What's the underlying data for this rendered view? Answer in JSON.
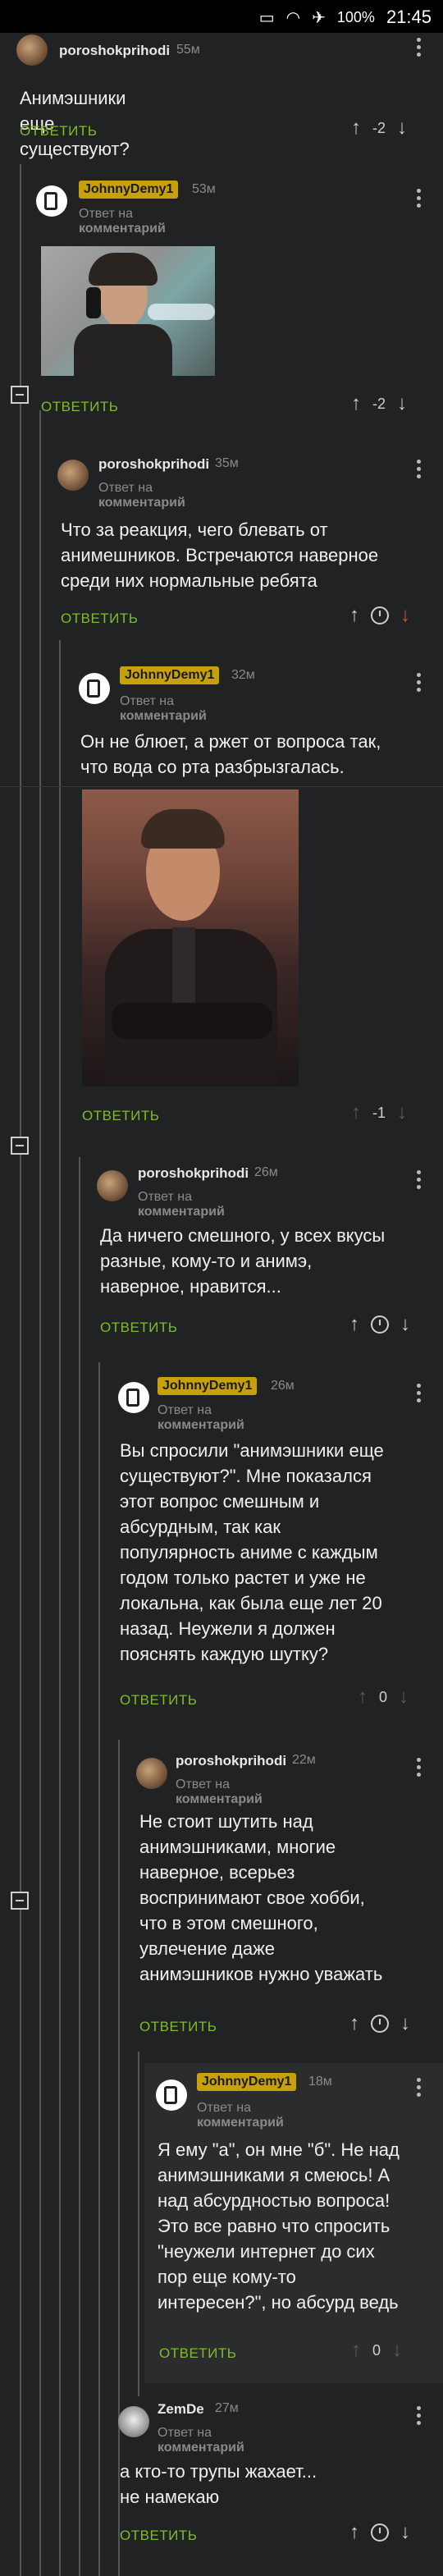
{
  "status": {
    "battery": "100%",
    "time": "21:45"
  },
  "comments": [
    {
      "user": "poroshokprihodi",
      "time": "55м",
      "text": "Анимэшники еще существуют?",
      "reply": "ОТВЕТИТЬ",
      "score": "-2"
    },
    {
      "user": "JohnnyDemy1",
      "time": "53м",
      "reply_to_prefix": "Ответ на",
      "reply_to_link": "комментарий",
      "reply": "ОТВЕТИТЬ",
      "score": "-2"
    },
    {
      "user": "poroshokprihodi",
      "time": "35м",
      "reply_to_prefix": "Ответ на",
      "reply_to_link": "комментарий",
      "text": [
        "Что за реакция, чего блевать от",
        "анимешников. Встречаются наверное",
        "среди них нормальные ребята"
      ],
      "reply": "ОТВЕТИТЬ"
    },
    {
      "user": "JohnnyDemy1",
      "time": "32м",
      "reply_to_prefix": "Ответ на",
      "reply_to_link": "комментарий",
      "text": [
        "Он не блюет, а ржет от вопроса так,",
        "что вода со рта разбрызгалась."
      ],
      "reply": "ОТВЕТИТЬ",
      "score": "-1"
    },
    {
      "user": "poroshokprihodi",
      "time": "26м",
      "reply_to_prefix": "Ответ на",
      "reply_to_link": "комментарий",
      "text": [
        "Да ничего смешного, у всех вкусы",
        "разные, кому-то и анимэ,",
        "наверное, нравится..."
      ],
      "reply": "ОТВЕТИТЬ"
    },
    {
      "user": "JohnnyDemy1",
      "time": "26м",
      "reply_to_prefix": "Ответ на",
      "reply_to_link": "комментарий",
      "text": [
        "Вы спросили \"анимэшники еще",
        "существуют?\". Мне показался",
        "этот вопрос смешным и",
        "абсурдным, так как",
        "популярность аниме с каждым",
        "годом только растет и уже не",
        "локальна, как была еще лет 20",
        "назад. Неужели я должен",
        "пояснять каждую шутку?"
      ],
      "reply": "ОТВЕТИТЬ",
      "score": "0"
    },
    {
      "user": "poroshokprihodi",
      "time": "22м",
      "reply_to_prefix": "Ответ на",
      "reply_to_link": "комментарий",
      "text": [
        "Не стоит шутить над",
        "анимэшниками, многие",
        "наверное, всерьез",
        "воспринимают свое хобби,",
        "что в этом смешного,",
        "увлечение даже",
        "анимэшников нужно уважать"
      ],
      "reply": "ОТВЕТИТЬ"
    },
    {
      "user": "JohnnyDemy1",
      "time": "18м",
      "reply_to_prefix": "Ответ на",
      "reply_to_link": "комментарий",
      "text": [
        "Я ему \"а\", он мне \"б\". Не над",
        "анимэшниками я смеюсь! А",
        "над абсурдностью вопроса!",
        "Это все равно что спросить",
        "\"неужели интернет до сих",
        "пор еще кому-то",
        "интересен?\", но абсурд ведь"
      ],
      "reply": "ОТВЕТИТЬ",
      "score": "0"
    },
    {
      "user": "ZemDe",
      "time": "27м",
      "reply_to_prefix": "Ответ на",
      "reply_to_link": "комментарий",
      "text": [
        "а кто-то трупы жахает...",
        "не намекаю"
      ],
      "reply": "ОТВЕТИТЬ"
    }
  ]
}
